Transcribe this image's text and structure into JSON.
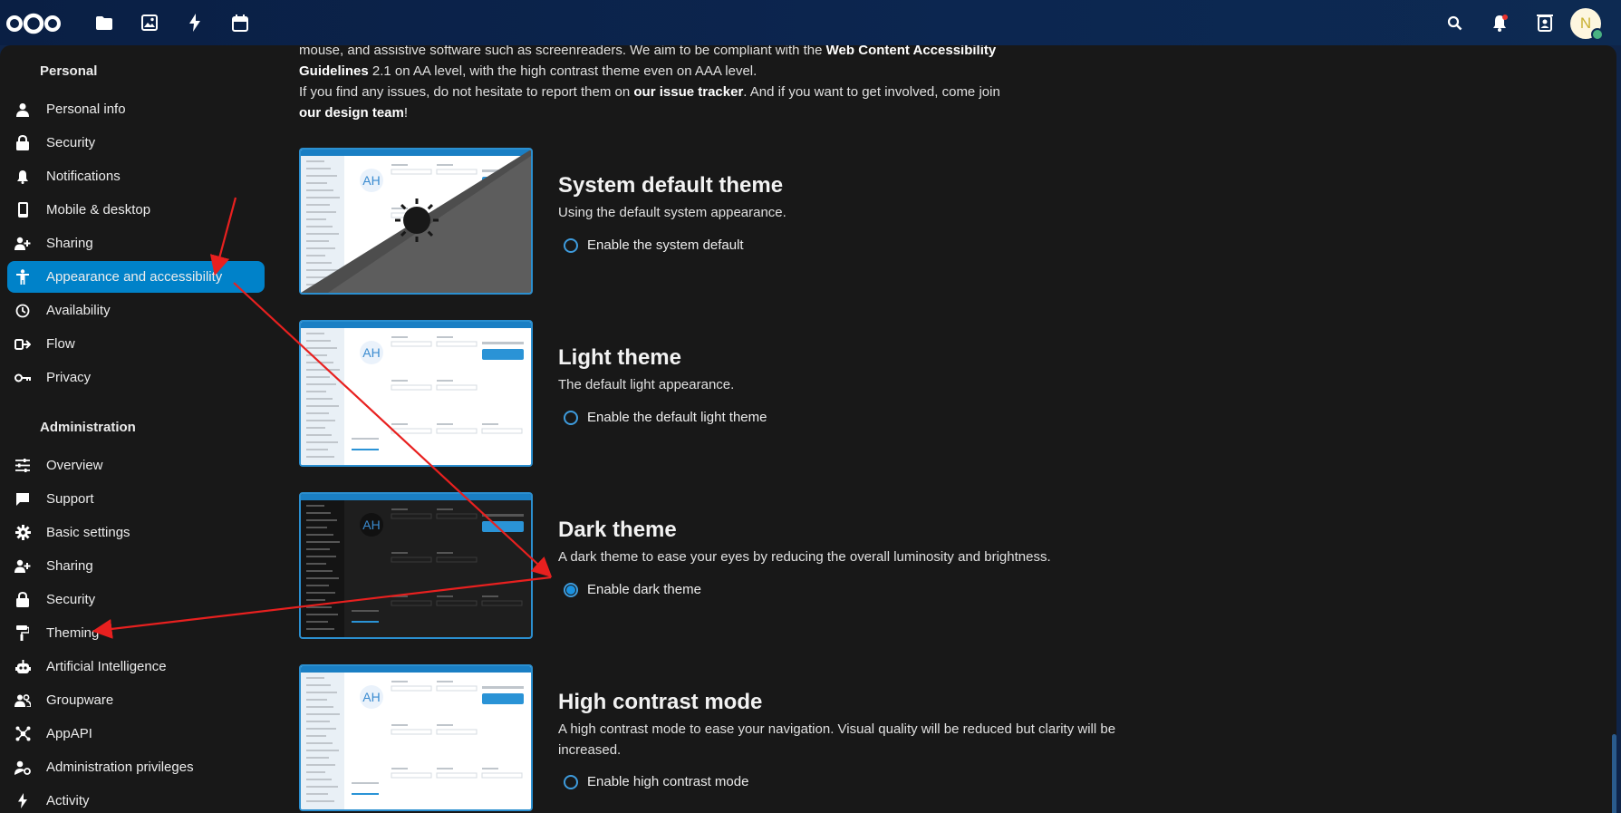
{
  "colors": {
    "accent": "#0082c9",
    "arrow": "#e8201f",
    "online": "#49b382"
  },
  "topbar": {
    "apps": [
      {
        "name": "files",
        "icon": "folder-icon"
      },
      {
        "name": "photos",
        "icon": "image-icon"
      },
      {
        "name": "activity",
        "icon": "lightning-icon"
      },
      {
        "name": "calendar",
        "icon": "calendar-icon"
      }
    ],
    "avatar_initial": "N"
  },
  "sidebar": {
    "personal_title": "Personal",
    "personal_items": [
      {
        "label": "Personal info",
        "icon": "person-icon"
      },
      {
        "label": "Security",
        "icon": "lock-icon"
      },
      {
        "label": "Notifications",
        "icon": "bell-icon"
      },
      {
        "label": "Mobile & desktop",
        "icon": "phone-icon"
      },
      {
        "label": "Sharing",
        "icon": "share-icon"
      },
      {
        "label": "Appearance and accessibility",
        "icon": "accessibility-icon",
        "active": true
      },
      {
        "label": "Availability",
        "icon": "clock-icon"
      },
      {
        "label": "Flow",
        "icon": "flow-icon"
      },
      {
        "label": "Privacy",
        "icon": "key-icon"
      }
    ],
    "admin_title": "Administration",
    "admin_items": [
      {
        "label": "Overview",
        "icon": "tune-icon"
      },
      {
        "label": "Support",
        "icon": "chat-icon"
      },
      {
        "label": "Basic settings",
        "icon": "gear-icon"
      },
      {
        "label": "Sharing",
        "icon": "share-icon"
      },
      {
        "label": "Security",
        "icon": "lock-icon"
      },
      {
        "label": "Theming",
        "icon": "paint-roller-icon"
      },
      {
        "label": "Artificial Intelligence",
        "icon": "robot-icon"
      },
      {
        "label": "Groupware",
        "icon": "group-icon"
      },
      {
        "label": "AppAPI",
        "icon": "api-icon"
      },
      {
        "label": "Administration privileges",
        "icon": "admin-icon"
      },
      {
        "label": "Activity",
        "icon": "lightning-icon"
      }
    ]
  },
  "intro": {
    "line1_a": "mouse, and assistive software such as screenreaders. We aim to be compliant with the ",
    "line1_b": "Web Content Accessibility Guidelines",
    "line1_c": " 2.1 on AA level, with the high contrast theme even on AAA level.",
    "line2_a": "If you find any issues, do not hesitate to report them on ",
    "line2_b": "our issue tracker",
    "line2_c": ". And if you want to get involved, come join ",
    "line2_d": "our design team",
    "line2_e": "!"
  },
  "themes": [
    {
      "title": "System default theme",
      "description": "Using the default system appearance.",
      "option": "Enable the system default",
      "checked": false,
      "preview": "system"
    },
    {
      "title": "Light theme",
      "description": "The default light appearance.",
      "option": "Enable the default light theme",
      "checked": false,
      "preview": "light"
    },
    {
      "title": "Dark theme",
      "description": "A dark theme to ease your eyes by reducing the overall luminosity and brightness.",
      "option": "Enable dark theme",
      "checked": true,
      "preview": "dark"
    },
    {
      "title": "High contrast mode",
      "description": "A high contrast mode to ease your navigation. Visual quality will be reduced but clarity will be increased.",
      "option": "Enable high contrast mode",
      "checked": false,
      "preview": "contrast"
    }
  ],
  "preview_avatar": "AH"
}
